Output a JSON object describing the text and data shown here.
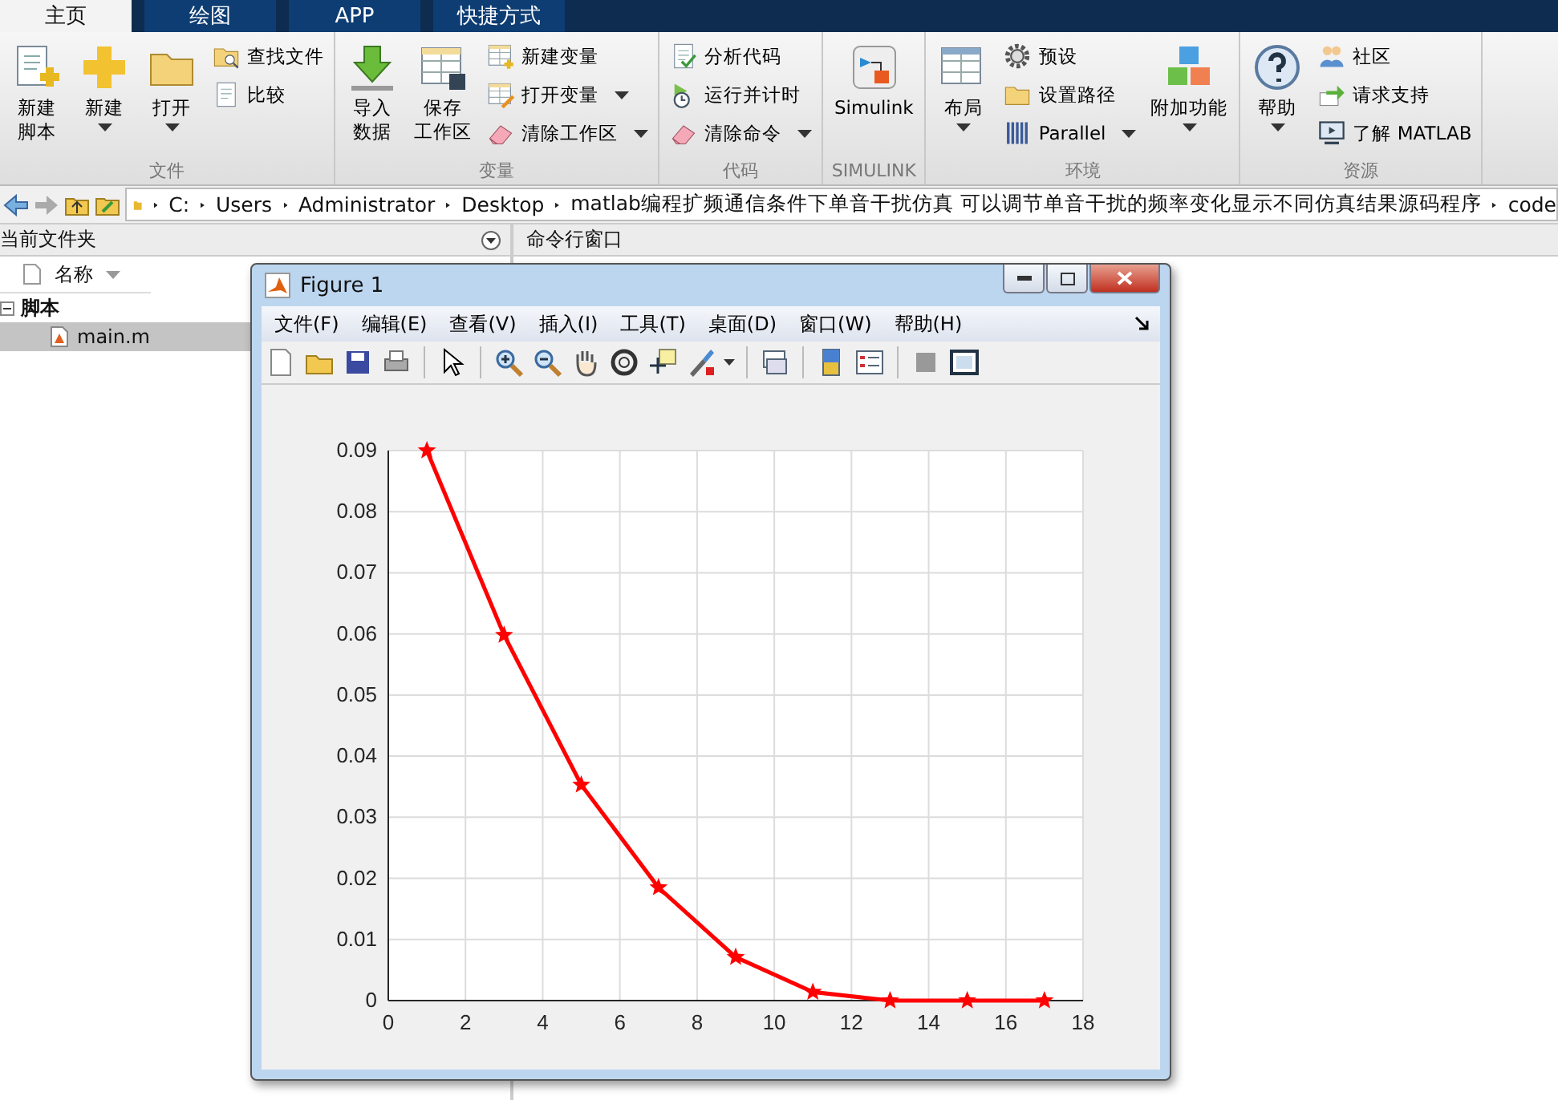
{
  "tabs": [
    {
      "label": "主页",
      "selected": true
    },
    {
      "label": "绘图",
      "selected": false
    },
    {
      "label": "APP",
      "selected": false
    },
    {
      "label": "快捷方式",
      "selected": false
    }
  ],
  "ribbon": {
    "groups": [
      {
        "title": "文件",
        "items": [
          {
            "kind": "large",
            "label": [
              "新建",
              "脚本"
            ],
            "dropdown": false
          },
          {
            "kind": "large",
            "label": "新建",
            "dropdown": true
          },
          {
            "kind": "large",
            "label": "打开",
            "dropdown": true
          },
          {
            "kind": "stack",
            "buttons": [
              {
                "label": "查找文件",
                "dropdown": false
              },
              {
                "label": "比较",
                "dropdown": false
              }
            ]
          }
        ]
      },
      {
        "title": "变量",
        "items": [
          {
            "kind": "large",
            "label": [
              "导入",
              "数据"
            ],
            "dropdown": false
          },
          {
            "kind": "large",
            "label": [
              "保存",
              "工作区"
            ],
            "dropdown": false
          },
          {
            "kind": "stack",
            "buttons": [
              {
                "label": "新建变量",
                "dropdown": false
              },
              {
                "label": "打开变量",
                "dropdown": true
              },
              {
                "label": "清除工作区",
                "dropdown": true
              }
            ]
          }
        ]
      },
      {
        "title": "代码",
        "items": [
          {
            "kind": "stack",
            "buttons": [
              {
                "label": "分析代码",
                "dropdown": false
              },
              {
                "label": "运行并计时",
                "dropdown": false
              },
              {
                "label": "清除命令",
                "dropdown": true
              }
            ]
          }
        ]
      },
      {
        "title": "SIMULINK",
        "items": [
          {
            "kind": "large",
            "label": "Simulink",
            "dropdown": false
          }
        ]
      },
      {
        "title": "环境",
        "items": [
          {
            "kind": "large",
            "label": "布局",
            "dropdown": true
          },
          {
            "kind": "stack",
            "buttons": [
              {
                "label": "预设",
                "dropdown": false
              },
              {
                "label": "设置路径",
                "dropdown": false
              },
              {
                "label": "Parallel",
                "dropdown": true
              }
            ]
          },
          {
            "kind": "large",
            "label": "附加功能",
            "dropdown": true
          }
        ]
      },
      {
        "title": "资源",
        "items": [
          {
            "kind": "large",
            "label": "帮助",
            "dropdown": true
          },
          {
            "kind": "stack",
            "buttons": [
              {
                "label": "社区",
                "dropdown": false
              },
              {
                "label": "请求支持",
                "dropdown": false
              },
              {
                "label": "了解 MATLAB",
                "dropdown": false
              }
            ]
          }
        ]
      }
    ]
  },
  "address_bar": {
    "path": [
      "C:",
      "Users",
      "Administrator",
      "Desktop",
      "matlab编程扩频通信条件下单音干扰仿真 可以调节单音干扰的频率变化显示不同仿真结果源码程序",
      "code"
    ]
  },
  "current_folder": {
    "title": "当前文件夹",
    "column": "名称",
    "tree": [
      {
        "label": "脚本",
        "expanded": true,
        "children": [
          {
            "label": "main.m",
            "selected": true
          }
        ]
      }
    ]
  },
  "command_window": {
    "title": "命令行窗口"
  },
  "figure": {
    "title": "Figure 1",
    "menu": [
      "文件(F)",
      "编辑(E)",
      "查看(V)",
      "插入(I)",
      "工具(T)",
      "桌面(D)",
      "窗口(W)",
      "帮助(H)"
    ],
    "chart_data": {
      "type": "line",
      "x": [
        1,
        3,
        5,
        7,
        9,
        11,
        13,
        15,
        17
      ],
      "grid": true,
      "series": [
        {
          "color": "#ff0000",
          "marker": "star",
          "values": [
            0.09,
            0.0598,
            0.0353,
            0.0185,
            0.0071,
            0.0014,
            0,
            0,
            0
          ]
        }
      ],
      "xlim": [
        0,
        18
      ],
      "ylim": [
        0,
        0.09
      ],
      "xticks": [
        0,
        2,
        4,
        6,
        8,
        10,
        12,
        14,
        16,
        18
      ],
      "yticks": [
        0,
        0.01,
        0.02,
        0.03,
        0.04,
        0.05,
        0.06,
        0.07,
        0.08,
        0.09
      ]
    }
  }
}
